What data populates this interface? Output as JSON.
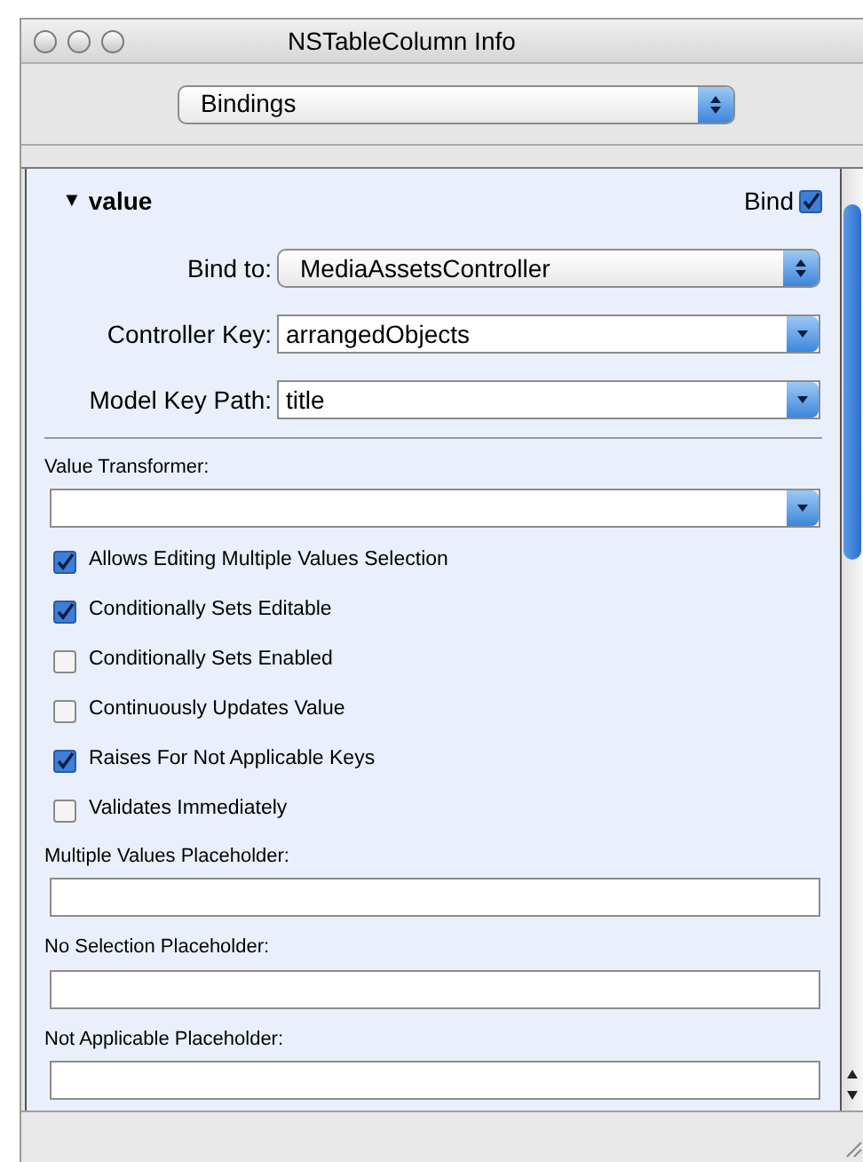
{
  "window": {
    "title": "NSTableColumn Info"
  },
  "pane_popup": {
    "value": "Bindings"
  },
  "section": {
    "title": "value",
    "expanded": true,
    "toggle": "▼",
    "bind": {
      "label": "Bind",
      "checked": true
    }
  },
  "fields": [
    {
      "label": "Bind to:",
      "value": "MediaAssetsController",
      "kind": "popup"
    },
    {
      "label": "Controller Key:",
      "value": "arrangedObjects",
      "kind": "combo"
    },
    {
      "label": "Model Key Path:",
      "value": "title",
      "kind": "combo"
    }
  ],
  "value_transformer": {
    "label": "Value Transformer:"
  },
  "options": [
    {
      "label": "Allows Editing Multiple Values Selection",
      "checked": true
    },
    {
      "label": "Conditionally Sets Editable",
      "checked": true
    },
    {
      "label": "Conditionally Sets Enabled",
      "checked": false
    },
    {
      "label": "Continuously Updates Value",
      "checked": false
    },
    {
      "label": "Raises For Not Applicable Keys",
      "checked": true
    },
    {
      "label": "Validates Immediately",
      "checked": false
    }
  ],
  "placeholders": [
    {
      "label": "Multiple Values Placeholder:"
    },
    {
      "label": "No Selection Placeholder:"
    },
    {
      "label": "Not Applicable Placeholder:"
    }
  ]
}
